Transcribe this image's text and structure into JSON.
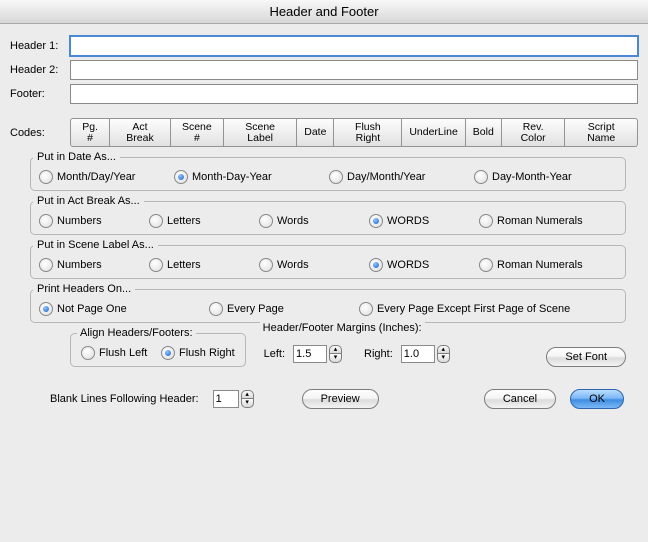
{
  "window": {
    "title": "Header and Footer"
  },
  "fields": {
    "header1_label": "Header 1:",
    "header2_label": "Header 2:",
    "footer_label": "Footer:",
    "header1_value": "",
    "header2_value": "",
    "footer_value": ""
  },
  "codes": {
    "label": "Codes:",
    "buttons": [
      "Pg. #",
      "Act Break",
      "Scene #",
      "Scene Label",
      "Date",
      "Flush Right",
      "UnderLine",
      "Bold",
      "Rev. Color",
      "Script Name"
    ]
  },
  "date_group": {
    "title": "Put in Date As...",
    "options": [
      "Month/Day/Year",
      "Month-Day-Year",
      "Day/Month/Year",
      "Day-Month-Year"
    ],
    "selected": 1
  },
  "act_group": {
    "title": "Put in Act Break As...",
    "options": [
      "Numbers",
      "Letters",
      "Words",
      "WORDS",
      "Roman Numerals"
    ],
    "selected": 3
  },
  "scene_group": {
    "title": "Put in Scene Label As...",
    "options": [
      "Numbers",
      "Letters",
      "Words",
      "WORDS",
      "Roman Numerals"
    ],
    "selected": 3
  },
  "print_group": {
    "title": "Print Headers On...",
    "options": [
      "Not Page One",
      "Every Page",
      "Every Page Except First Page of Scene"
    ],
    "selected": 0
  },
  "align": {
    "title": "Align Headers/Footers:",
    "options": [
      "Flush Left",
      "Flush Right"
    ],
    "selected": 1
  },
  "margins": {
    "title": "Header/Footer Margins (Inches):",
    "left_label": "Left:",
    "left_value": "1.5",
    "right_label": "Right:",
    "right_value": "1.0"
  },
  "setfont_label": "Set Font",
  "blank_lines": {
    "label": "Blank Lines Following Header:",
    "value": "1"
  },
  "buttons": {
    "preview": "Preview",
    "cancel": "Cancel",
    "ok": "OK"
  }
}
